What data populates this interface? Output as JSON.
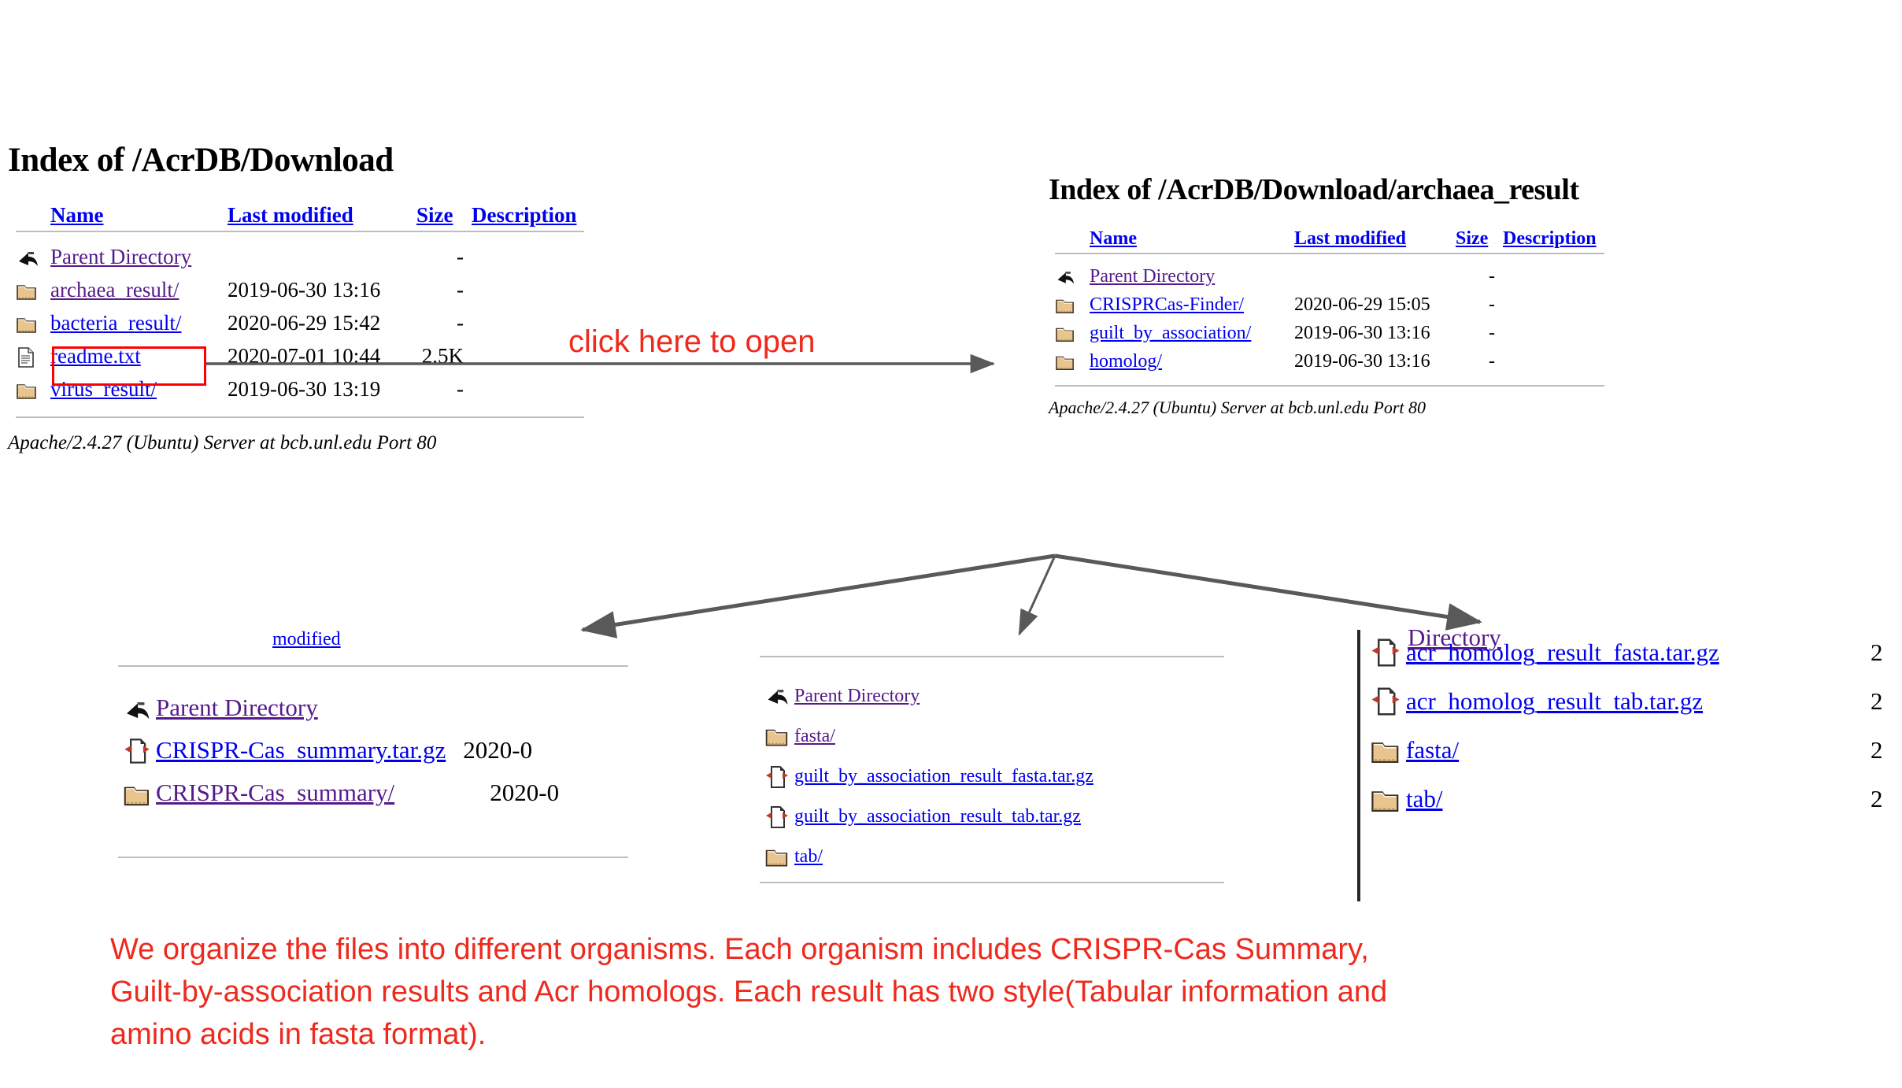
{
  "columns": {
    "name": "Name",
    "last_modified": "Last modified",
    "size": "Size",
    "description": "Description"
  },
  "apache_signature": "Apache/2.4.27 (Ubuntu) Server at bcb.unl.edu Port 80",
  "parent_directory_label": "Parent Directory",
  "panels": {
    "download": {
      "title": "Index of /AcrDB/Download",
      "rows": [
        {
          "icon": "back-icon",
          "name": "Parent Directory",
          "date": "",
          "size": "-",
          "desc": "",
          "state": "visited"
        },
        {
          "icon": "folder-icon",
          "name": "archaea_result/",
          "date": "2019-06-30 13:16",
          "size": "-",
          "desc": "",
          "state": "visited"
        },
        {
          "icon": "folder-icon",
          "name": "bacteria_result/",
          "date": "2020-06-29 15:42",
          "size": "-",
          "desc": "",
          "state": "unvisited"
        },
        {
          "icon": "text-icon",
          "name": "readme.txt",
          "date": "2020-07-01 10:44",
          "size": "2.5K",
          "desc": "",
          "state": "unvisited"
        },
        {
          "icon": "folder-icon",
          "name": "virus_result/",
          "date": "2019-06-30 13:19",
          "size": "-",
          "desc": "",
          "state": "unvisited"
        }
      ]
    },
    "archaea": {
      "title": "Index of /AcrDB/Download/archaea_result",
      "rows": [
        {
          "icon": "back-icon",
          "name": "Parent Directory",
          "date": "",
          "size": "-",
          "desc": "",
          "state": "visited"
        },
        {
          "icon": "folder-icon",
          "name": "CRISPRCas-Finder/",
          "date": "2020-06-29 15:05",
          "size": "-",
          "desc": "",
          "state": "unvisited"
        },
        {
          "icon": "folder-icon",
          "name": "guilt_by_association/",
          "date": "2019-06-30 13:16",
          "size": "-",
          "desc": "",
          "state": "unvisited"
        },
        {
          "icon": "folder-icon",
          "name": "homolog/",
          "date": "2019-06-30 13:16",
          "size": "-",
          "desc": "",
          "state": "unvisited"
        }
      ]
    },
    "crisprcas": {
      "rows": [
        {
          "icon": "back-icon",
          "name": "Parent Directory",
          "date": "",
          "size": "",
          "desc": "",
          "state": "visited"
        },
        {
          "icon": "targz-icon",
          "name": "CRISPR-Cas_summary.tar.gz",
          "date": "2020-0",
          "size": "",
          "desc": "",
          "state": "unvisited"
        },
        {
          "icon": "folder-icon",
          "name": "CRISPR-Cas_summary/",
          "date": "2020-0",
          "size": "",
          "desc": "",
          "state": "visited"
        }
      ]
    },
    "guilt": {
      "rows": [
        {
          "icon": "back-icon",
          "name": "Parent Directory",
          "date": "",
          "size": "",
          "desc": "",
          "state": "visited"
        },
        {
          "icon": "folder-icon",
          "name": "fasta/",
          "date": "",
          "size": "",
          "desc": "",
          "state": "visited"
        },
        {
          "icon": "targz-icon",
          "name": "guilt_by_association_result_fasta.tar.gz",
          "date": "",
          "size": "",
          "desc": "",
          "state": "unvisited"
        },
        {
          "icon": "targz-icon",
          "name": "guilt_by_association_result_tab.tar.gz",
          "date": "",
          "size": "",
          "desc": "",
          "state": "unvisited"
        },
        {
          "icon": "folder-icon",
          "name": "tab/",
          "date": "",
          "size": "",
          "desc": "",
          "state": "unvisited"
        }
      ]
    },
    "homolog": {
      "rows": [
        {
          "icon": "targz-icon",
          "name": "acr_homolog_result_fasta.tar.gz",
          "date": "2",
          "size": "",
          "desc": "",
          "state": "unvisited"
        },
        {
          "icon": "targz-icon",
          "name": "acr_homolog_result_tab.tar.gz",
          "date": "2",
          "size": "",
          "desc": "",
          "state": "unvisited"
        },
        {
          "icon": "folder-icon",
          "name": "fasta/",
          "date": "2",
          "size": "",
          "desc": "",
          "state": "unvisited"
        },
        {
          "icon": "folder-icon",
          "name": "tab/",
          "date": "2",
          "size": "",
          "desc": "",
          "state": "unvisited"
        }
      ]
    }
  },
  "annotations": {
    "click_here": "click here to open",
    "caption_line1": "We organize the files into different organisms. Each organism includes CRISPR-Cas Summary,",
    "caption_line2": "Guilt-by-association results and Acr homologs. Each result has two style(Tabular information and",
    "caption_line3": "amino acids in fasta format)."
  },
  "colors": {
    "annotation_red": "#ee2a1e",
    "highlight_box": "#ff0000",
    "link_unvisited": "#0000ee",
    "link_visited": "#551a8b",
    "arrow_gray": "#595959",
    "rule_gray": "#bdbdbd"
  }
}
